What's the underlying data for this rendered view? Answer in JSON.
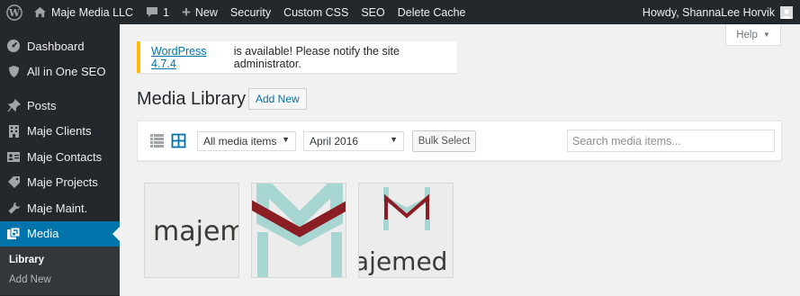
{
  "adminbar": {
    "site_name": "Maje Media LLC",
    "comments_count": "1",
    "new_label": "New",
    "links": [
      "Security",
      "Custom CSS",
      "SEO",
      "Delete Cache"
    ],
    "greeting": "Howdy, ShannaLee Horvik"
  },
  "sidebar": {
    "items": [
      {
        "label": "Dashboard",
        "icon": "dashboard-icon"
      },
      {
        "label": "All in One SEO",
        "icon": "shield-icon"
      },
      {
        "label": "Posts",
        "icon": "pin-icon"
      },
      {
        "label": "Maje Clients",
        "icon": "building-icon"
      },
      {
        "label": "Maje Contacts",
        "icon": "id-card-icon"
      },
      {
        "label": "Maje Projects",
        "icon": "tag-icon"
      },
      {
        "label": "Maje Maint.",
        "icon": "wrench-icon"
      },
      {
        "label": "Media",
        "icon": "media-icon"
      }
    ],
    "submenu": [
      "Library",
      "Add New"
    ]
  },
  "help_label": "Help",
  "notice": {
    "link": "WordPress 4.7.4",
    "text": "is available! Please notify the site administrator."
  },
  "page_title": "Media Library",
  "add_new_label": "Add New",
  "toolbar": {
    "type_filter": "All media items",
    "date_filter": "April 2016",
    "bulk_select_label": "Bulk Select",
    "search_placeholder": "Search media items..."
  },
  "attachments": {
    "thumb1_text": "majem",
    "thumb3_text": "ajemed"
  },
  "colors": {
    "accent": "#0073aa",
    "notice_border": "#ffb900",
    "logo_red": "#8b1d24",
    "logo_teal": "#a7d5d2"
  }
}
